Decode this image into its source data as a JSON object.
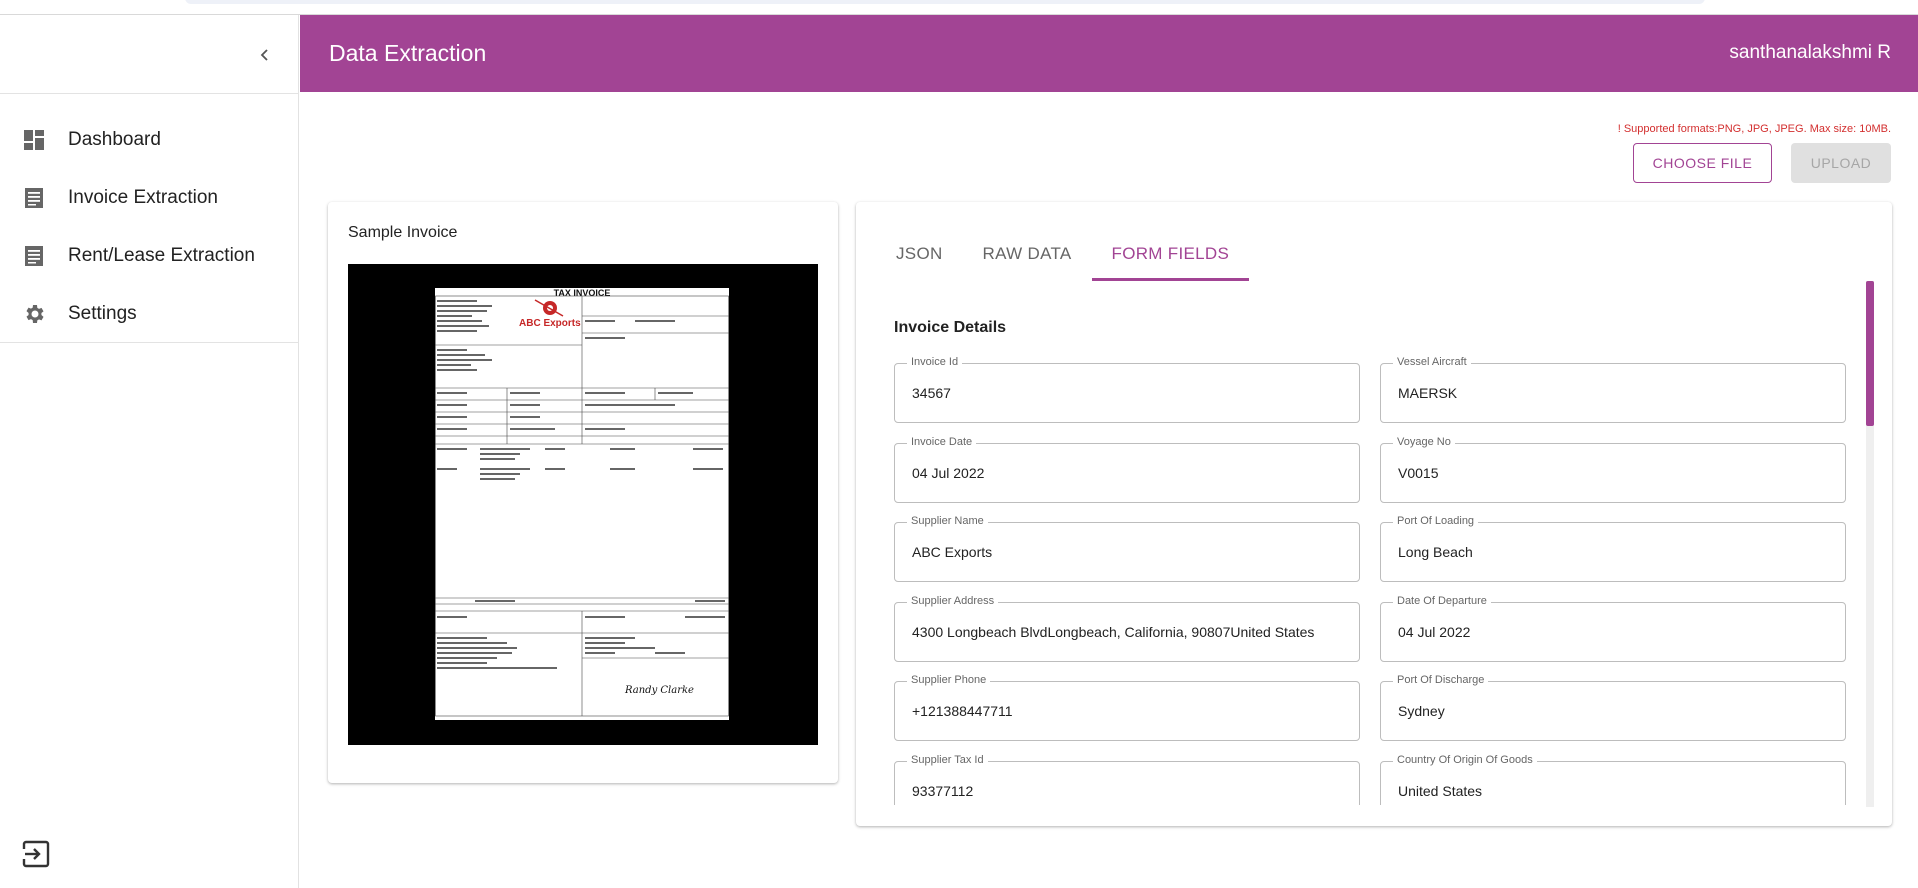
{
  "app": {
    "title": "Data Extraction",
    "user": "santhanalakshmi R",
    "accent_color": "#a24494"
  },
  "sidebar": {
    "collapse_icon": "chevron-left-icon",
    "items": [
      {
        "label": "Dashboard",
        "icon": "dashboard-icon"
      },
      {
        "label": "Invoice Extraction",
        "icon": "document-icon"
      },
      {
        "label": "Rent/Lease Extraction",
        "icon": "document-icon"
      },
      {
        "label": "Settings",
        "icon": "gear-icon"
      }
    ],
    "logout_icon": "logout-icon"
  },
  "upload": {
    "notice": "! Supported formats:PNG, JPG, JPEG. Max size: 10MB.",
    "choose_label": "CHOOSE FILE",
    "upload_label": "UPLOAD"
  },
  "preview": {
    "title": "Sample Invoice",
    "doc_title": "TAX INVOICE",
    "brand": "ABC Exports",
    "signature": "Randy Clarke"
  },
  "tabs": [
    {
      "label": "JSON",
      "active": false
    },
    {
      "label": "RAW DATA",
      "active": false
    },
    {
      "label": "FORM FIELDS",
      "active": true
    }
  ],
  "form": {
    "section_title": "Invoice Details",
    "fields_left": [
      {
        "label": "Invoice Id",
        "value": "34567"
      },
      {
        "label": "Invoice Date",
        "value": "04 Jul 2022"
      },
      {
        "label": "Supplier Name",
        "value": "ABC Exports"
      },
      {
        "label": "Supplier Address",
        "value": "4300 Longbeach BlvdLongbeach, California, 90807United States"
      },
      {
        "label": "Supplier Phone",
        "value": "+121388447711"
      },
      {
        "label": "Supplier Tax Id",
        "value": "93377112"
      }
    ],
    "fields_right": [
      {
        "label": "Vessel Aircraft",
        "value": "MAERSK"
      },
      {
        "label": "Voyage No",
        "value": "V0015"
      },
      {
        "label": "Port Of Loading",
        "value": "Long Beach"
      },
      {
        "label": "Date Of Departure",
        "value": "04 Jul 2022"
      },
      {
        "label": "Port Of Discharge",
        "value": "Sydney"
      },
      {
        "label": "Country Of Origin Of Goods",
        "value": "United States"
      }
    ]
  }
}
